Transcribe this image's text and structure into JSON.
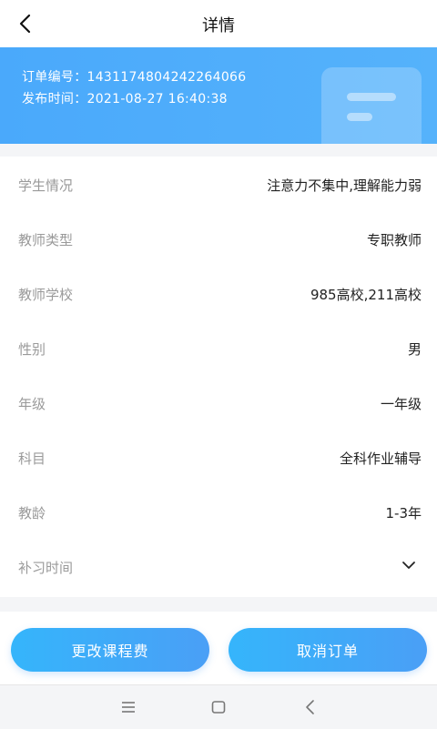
{
  "header": {
    "title": "详情",
    "back_icon": "chevron-left-icon"
  },
  "order": {
    "number_label": "订单编号：",
    "number": "1431174804242264066",
    "time_label": "发布时间：",
    "time": "2021-08-27 16:40:38",
    "decor_icon": "document-icon"
  },
  "details": [
    {
      "label": "学生情况",
      "value": "注意力不集中,理解能力弱"
    },
    {
      "label": "教师类型",
      "value": "专职教师"
    },
    {
      "label": "教师学校",
      "value": "985高校,211高校"
    },
    {
      "label": "性别",
      "value": "男"
    },
    {
      "label": "年级",
      "value": "一年级"
    },
    {
      "label": "科目",
      "value": "全科作业辅导"
    },
    {
      "label": "教龄",
      "value": "1-3年"
    },
    {
      "label": "补习时间",
      "value": "",
      "icon": "chevron-down-icon"
    }
  ],
  "actions": {
    "change_fee_label": "更改课程费",
    "cancel_order_label": "取消订单"
  },
  "system_nav": {
    "menu_icon": "menu-icon",
    "home_icon": "square-icon",
    "back_icon": "back-triangle-icon"
  },
  "colors": {
    "accent": "#4aa9fb",
    "button": "#3aa9f8",
    "label": "#9a9a9a"
  }
}
